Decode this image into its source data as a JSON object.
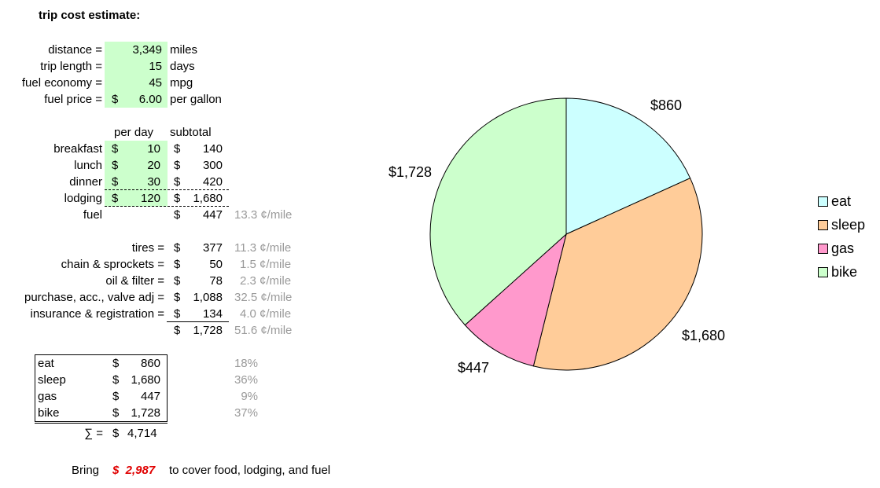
{
  "title": "trip cost estimate:",
  "inputs": [
    {
      "label": "distance =",
      "value": "3,349",
      "unit": "miles"
    },
    {
      "label": "trip length =",
      "value": "15",
      "unit": "days"
    },
    {
      "label": "fuel economy =",
      "value": "45",
      "unit": "mpg"
    },
    {
      "label": "fuel price =",
      "dollar": "$",
      "value": "6.00",
      "unit": "per gallon"
    }
  ],
  "daily_header": {
    "per_day": "per day",
    "subtotal": "subtotal"
  },
  "daily": [
    {
      "label": "breakfast",
      "d1": "$",
      "per_day": "10",
      "d2": "$",
      "subtotal": "140"
    },
    {
      "label": "lunch",
      "d1": "$",
      "per_day": "20",
      "d2": "$",
      "subtotal": "300"
    },
    {
      "label": "dinner",
      "d1": "$",
      "per_day": "30",
      "d2": "$",
      "subtotal": "420"
    },
    {
      "label": "lodging",
      "d1": "$",
      "per_day": "120",
      "d2": "$",
      "subtotal": "1,680"
    }
  ],
  "fuel_row": {
    "label": "fuel",
    "d2": "$",
    "subtotal": "447",
    "rate": "13.3 ¢/mile"
  },
  "bike_costs": [
    {
      "label": "tires =",
      "d": "$",
      "value": "377",
      "rate": "11.3 ¢/mile"
    },
    {
      "label": "chain & sprockets =",
      "d": "$",
      "value": "50",
      "rate": "1.5 ¢/mile"
    },
    {
      "label": "oil & filter =",
      "d": "$",
      "value": "78",
      "rate": "2.3 ¢/mile"
    },
    {
      "label": "purchase, acc., valve adj =",
      "d": "$",
      "value": "1,088",
      "rate": "32.5 ¢/mile"
    },
    {
      "label": "insurance & registration =",
      "d": "$",
      "value": "134",
      "rate": "4.0 ¢/mile"
    }
  ],
  "bike_total": {
    "d": "$",
    "value": "1,728",
    "rate": "51.6 ¢/mile"
  },
  "summary": [
    {
      "label": "eat",
      "d": "$",
      "value": "860",
      "pct": "18%"
    },
    {
      "label": "sleep",
      "d": "$",
      "value": "1,680",
      "pct": "36%"
    },
    {
      "label": "gas",
      "d": "$",
      "value": "447",
      "pct": "9%"
    },
    {
      "label": "bike",
      "d": "$",
      "value": "1,728",
      "pct": "37%"
    }
  ],
  "sum_row": {
    "label": "∑ =",
    "d": "$",
    "value": "4,714"
  },
  "bring": {
    "prefix": "Bring",
    "amount": "$  2,987",
    "suffix": "to cover food, lodging, and fuel"
  },
  "chart_data": {
    "type": "pie",
    "categories": [
      "eat",
      "sleep",
      "gas",
      "bike"
    ],
    "values": [
      860,
      1680,
      447,
      1728
    ],
    "data_labels": [
      "$860",
      "$1,680",
      "$447",
      "$1,728"
    ],
    "colors": [
      "#ccffff",
      "#ffcc99",
      "#ff99cc",
      "#ccffcc"
    ],
    "legend_position": "right",
    "start": "top, clockwise"
  }
}
